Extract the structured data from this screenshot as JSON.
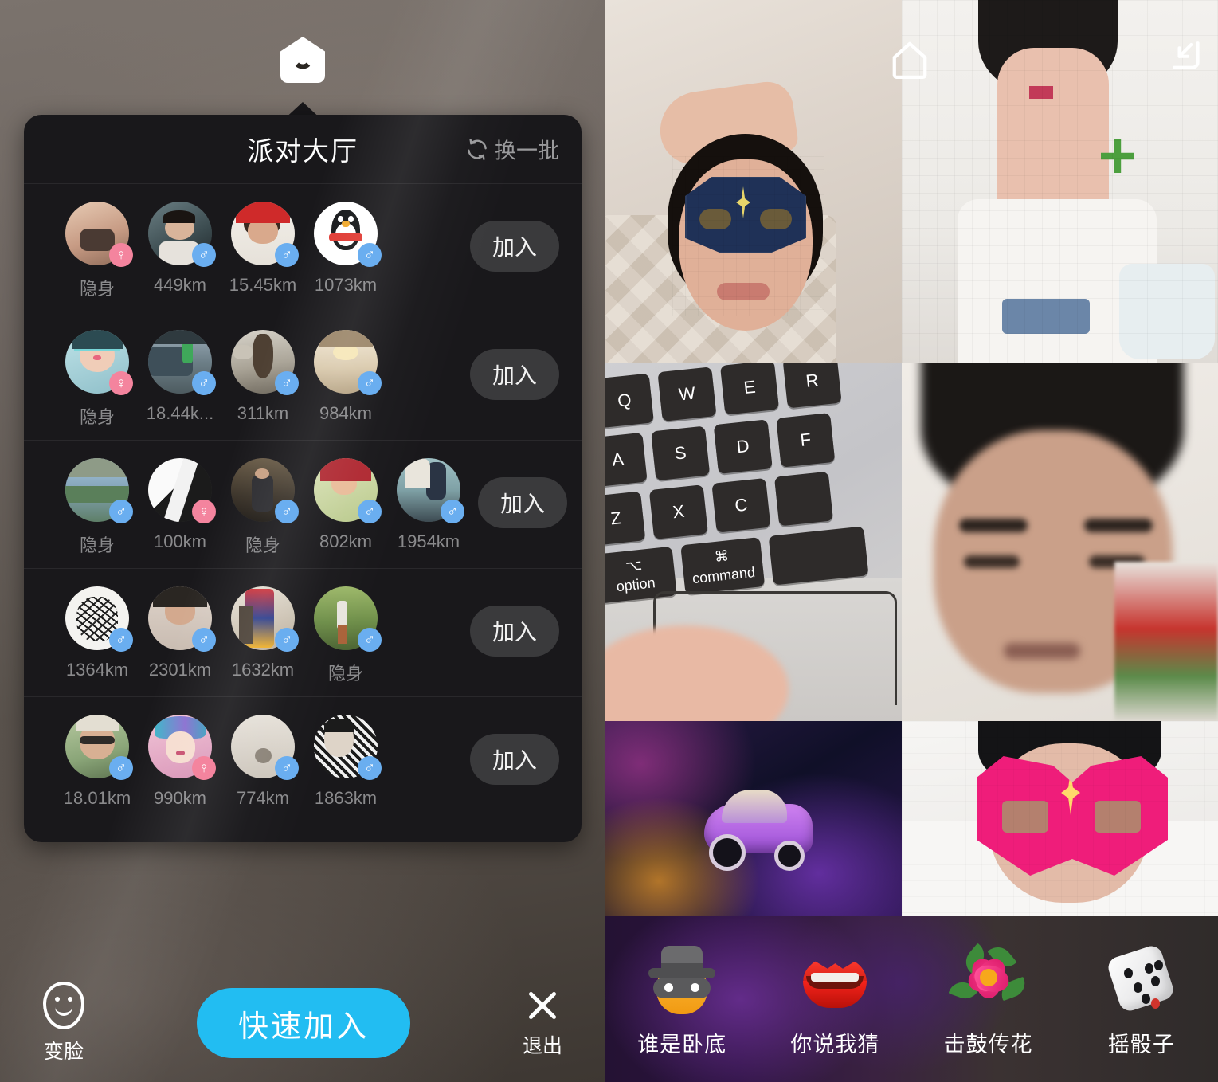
{
  "left_panel": {
    "home_icon": "home-smile-icon",
    "sheet": {
      "title": "派对大厅",
      "refresh_label": "换一批",
      "refresh_icon": "refresh-icon",
      "join_label": "加入",
      "rows": [
        {
          "join_label": "加入",
          "members": [
            {
              "distance": "隐身",
              "gender": "f",
              "gender_symbol": "♀"
            },
            {
              "distance": "449km",
              "gender": "m",
              "gender_symbol": "♂"
            },
            {
              "distance": "15.45km",
              "gender": "m",
              "gender_symbol": "♂"
            },
            {
              "distance": "1073km",
              "gender": "m",
              "gender_symbol": "♂"
            }
          ]
        },
        {
          "join_label": "加入",
          "members": [
            {
              "distance": "隐身",
              "gender": "f",
              "gender_symbol": "♀"
            },
            {
              "distance": "18.44k...",
              "gender": "m",
              "gender_symbol": "♂"
            },
            {
              "distance": "311km",
              "gender": "m",
              "gender_symbol": "♂"
            },
            {
              "distance": "984km",
              "gender": "m",
              "gender_symbol": "♂"
            }
          ]
        },
        {
          "join_label": "加入",
          "members": [
            {
              "distance": "隐身",
              "gender": "m",
              "gender_symbol": "♂"
            },
            {
              "distance": "100km",
              "gender": "f",
              "gender_symbol": "♀"
            },
            {
              "distance": "隐身",
              "gender": "m",
              "gender_symbol": "♂"
            },
            {
              "distance": "802km",
              "gender": "m",
              "gender_symbol": "♂"
            },
            {
              "distance": "1954km",
              "gender": "m",
              "gender_symbol": "♂"
            }
          ]
        },
        {
          "join_label": "加入",
          "members": [
            {
              "distance": "1364km",
              "gender": "m",
              "gender_symbol": "♂"
            },
            {
              "distance": "2301km",
              "gender": "m",
              "gender_symbol": "♂"
            },
            {
              "distance": "1632km",
              "gender": "m",
              "gender_symbol": "♂"
            },
            {
              "distance": "隐身",
              "gender": "m",
              "gender_symbol": "♂"
            }
          ]
        },
        {
          "join_label": "加入",
          "members": [
            {
              "distance": "18.01km",
              "gender": "m",
              "gender_symbol": "♂"
            },
            {
              "distance": "990km",
              "gender": "f",
              "gender_symbol": "♀"
            },
            {
              "distance": "774km",
              "gender": "m",
              "gender_symbol": "♂"
            },
            {
              "distance": "1863km",
              "gender": "m",
              "gender_symbol": "♂"
            }
          ]
        }
      ]
    },
    "bottom_bar": {
      "face_label": "变脸",
      "face_icon": "smiley-face-icon",
      "quick_join_label": "快速加入",
      "exit_label": "退出",
      "exit_icon": "close-x-icon"
    }
  },
  "right_panel": {
    "home_icon": "home-outline-icon",
    "shrink_icon": "shrink-screen-icon",
    "tiles": [
      {
        "name": "tile-masked-man-bed"
      },
      {
        "name": "tile-pixelated-woman-cup"
      },
      {
        "name": "tile-macbook-keyboard"
      },
      {
        "name": "tile-blurred-man-face"
      },
      {
        "name": "tile-purple-sports-car"
      },
      {
        "name": "tile-pink-mask-face"
      }
    ],
    "games": [
      {
        "label": "谁是卧底",
        "icon": "spy-emoji"
      },
      {
        "label": "你说我猜",
        "icon": "lips-emoji"
      },
      {
        "label": "击鼓传花",
        "icon": "flower-emoji"
      },
      {
        "label": "摇骰子",
        "icon": "dice-emoji"
      }
    ]
  },
  "colors": {
    "accent_blue": "#22bdf2",
    "male_badge": "#6aaef0",
    "female_badge": "#f4849e",
    "sheet_bg": "#19181b",
    "join_btn": "#3a3a3c"
  }
}
